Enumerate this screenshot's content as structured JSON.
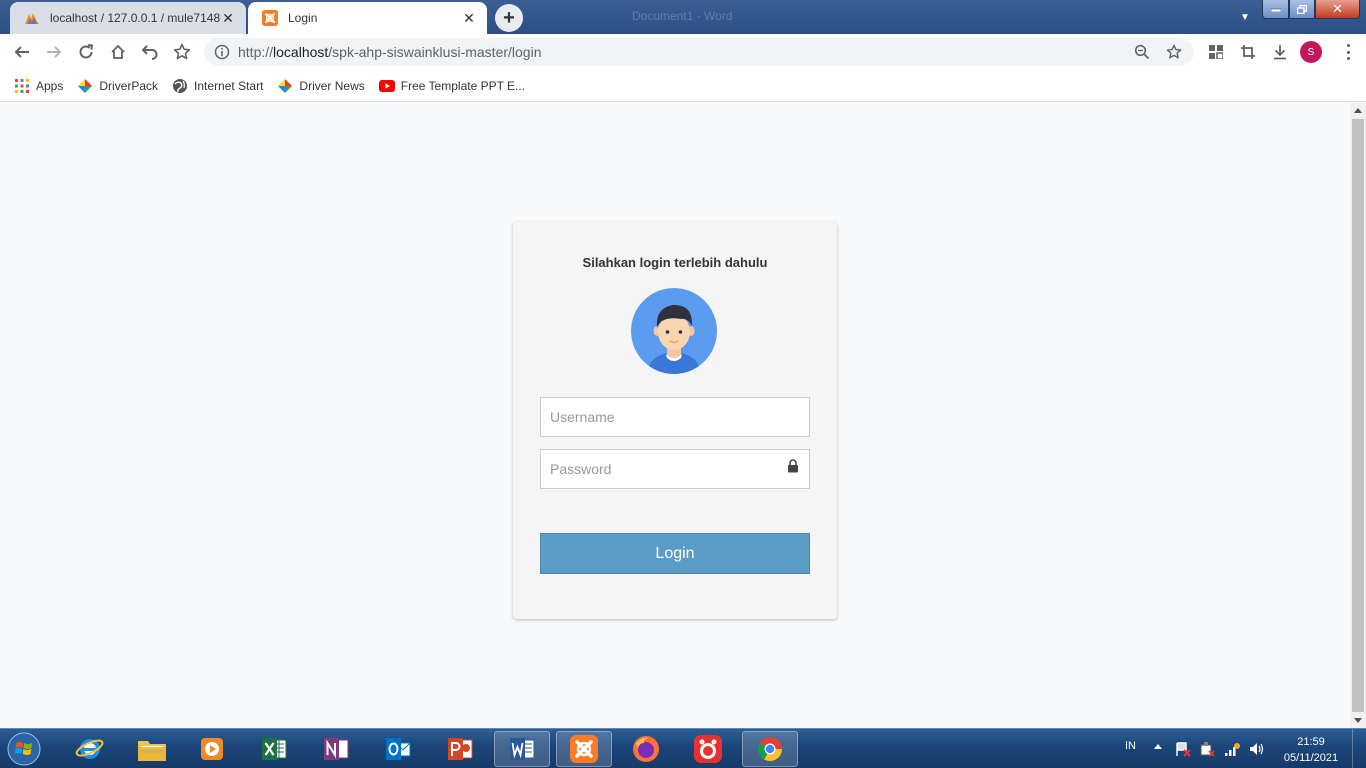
{
  "browser": {
    "tabs": [
      {
        "title": "localhost / 127.0.0.1 / mule7148_",
        "active": false,
        "favicon": "phpmyadmin-icon"
      },
      {
        "title": "Login",
        "active": true,
        "favicon": "xampp-icon"
      }
    ],
    "window_title": "Document1 - Word",
    "url": {
      "scheme": "http://",
      "host": "localhost",
      "path": "/spk-ahp-siswainklusi-master/login"
    },
    "profile_initial": "S",
    "bookmarks": [
      {
        "label": "Apps",
        "icon": "apps-grid-icon"
      },
      {
        "label": "DriverPack",
        "icon": "driverpack-icon"
      },
      {
        "label": "Internet Start",
        "icon": "globe-icon"
      },
      {
        "label": "Driver News",
        "icon": "driverpack-icon"
      },
      {
        "label": "Free Template PPT E...",
        "icon": "youtube-icon"
      }
    ]
  },
  "login": {
    "heading": "Silahkan login terlebih dahulu",
    "username_placeholder": "Username",
    "password_placeholder": "Password",
    "button_label": "Login"
  },
  "taskbar": {
    "apps": [
      "internet-explorer",
      "file-explorer",
      "media-player",
      "excel",
      "onenote",
      "outlook",
      "powerpoint",
      "word",
      "xampp",
      "firefox",
      "app-red",
      "chrome"
    ],
    "language": "IN",
    "time": "21:59",
    "date": "05/11/2021"
  },
  "colors": {
    "login_button": "#5b9cc7",
    "taskbar": "#1b4578",
    "profile": "#c2185b"
  }
}
